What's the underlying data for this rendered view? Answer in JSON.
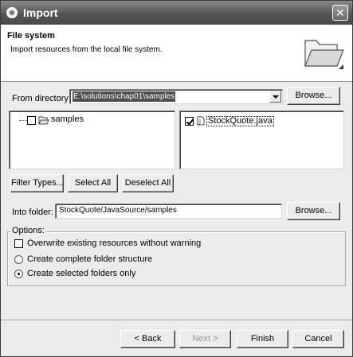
{
  "window": {
    "title": "Import"
  },
  "header": {
    "title": "File system",
    "description": "Import resources from the local file system."
  },
  "from_directory": {
    "label": "From directory:",
    "value": "E:\\solutions\\chap01\\samples",
    "browse_label": "Browse..."
  },
  "left_tree": {
    "items": [
      {
        "label": "samples",
        "checked": false,
        "icon": "folder-open-icon"
      }
    ]
  },
  "right_list": {
    "items": [
      {
        "label": "StockQuote.java",
        "checked": true,
        "icon": "java-file-icon"
      }
    ]
  },
  "selection_buttons": {
    "filter_types": "Filter Types...",
    "select_all": "Select All",
    "deselect_all": "Deselect All"
  },
  "into_folder": {
    "label": "Into folder:",
    "value": "StockQuote/JavaSource/samples",
    "browse_label": "Browse..."
  },
  "options": {
    "title": "Options:",
    "overwrite_label": "Overwrite existing resources without warning",
    "complete_structure_label": "Create complete folder structure",
    "selected_folders_label": "Create selected folders only",
    "selected": "selected_folders"
  },
  "footer": {
    "back": "< Back",
    "next": "Next >",
    "finish": "Finish",
    "cancel": "Cancel"
  }
}
